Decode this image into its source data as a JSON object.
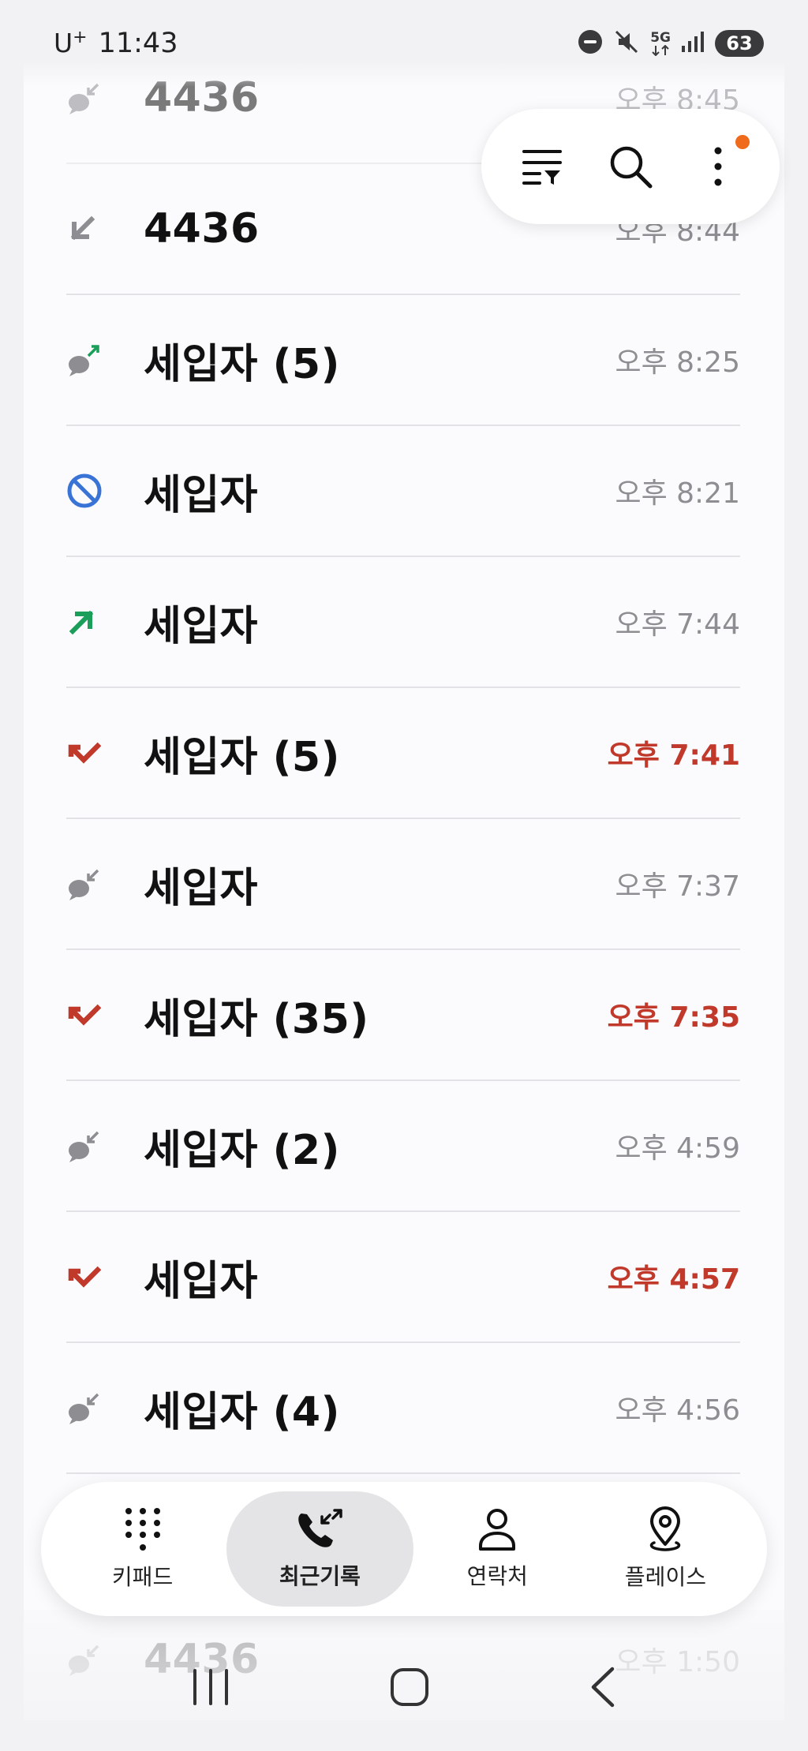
{
  "status_bar": {
    "carrier": "U",
    "carrier_sup": "+",
    "time": "11:43",
    "network": "5G",
    "battery": "63"
  },
  "calls": [
    {
      "type": "sms-incoming",
      "name": "4436",
      "time": "오후 8:45",
      "missed": false
    },
    {
      "type": "incoming",
      "name": "4436",
      "time": "오후 8:44",
      "missed": false
    },
    {
      "type": "sms-outgoing",
      "name": "세입자 (5)",
      "time": "오후 8:25",
      "missed": false
    },
    {
      "type": "blocked",
      "name": "세입자",
      "time": "오후 8:21",
      "missed": false
    },
    {
      "type": "outgoing",
      "name": "세입자",
      "time": "오후 7:44",
      "missed": false
    },
    {
      "type": "missed",
      "name": "세입자 (5)",
      "time": "오후 7:41",
      "missed": true
    },
    {
      "type": "sms-incoming",
      "name": "세입자",
      "time": "오후 7:37",
      "missed": false
    },
    {
      "type": "missed",
      "name": "세입자 (35)",
      "time": "오후 7:35",
      "missed": true
    },
    {
      "type": "sms-incoming",
      "name": "세입자 (2)",
      "time": "오후 4:59",
      "missed": false
    },
    {
      "type": "missed",
      "name": "세입자",
      "time": "오후 4:57",
      "missed": true
    },
    {
      "type": "sms-incoming",
      "name": "세입자 (4)",
      "time": "오후 4:56",
      "missed": false
    },
    {
      "type": "sms-incoming",
      "name": "4436",
      "time": "오후 1:50",
      "missed": false
    }
  ],
  "tabs": [
    {
      "label": "키패드",
      "icon": "keypad-icon",
      "active": false
    },
    {
      "label": "최근기록",
      "icon": "recents-icon",
      "active": true
    },
    {
      "label": "연락처",
      "icon": "contacts-icon",
      "active": false
    },
    {
      "label": "플레이스",
      "icon": "places-icon",
      "active": false
    }
  ],
  "colors": {
    "missed": "#c0392b",
    "outgoing": "#1a9e5a",
    "blocked": "#3a73d6",
    "muted": "#8e8e92",
    "notify": "#f06a1b"
  }
}
